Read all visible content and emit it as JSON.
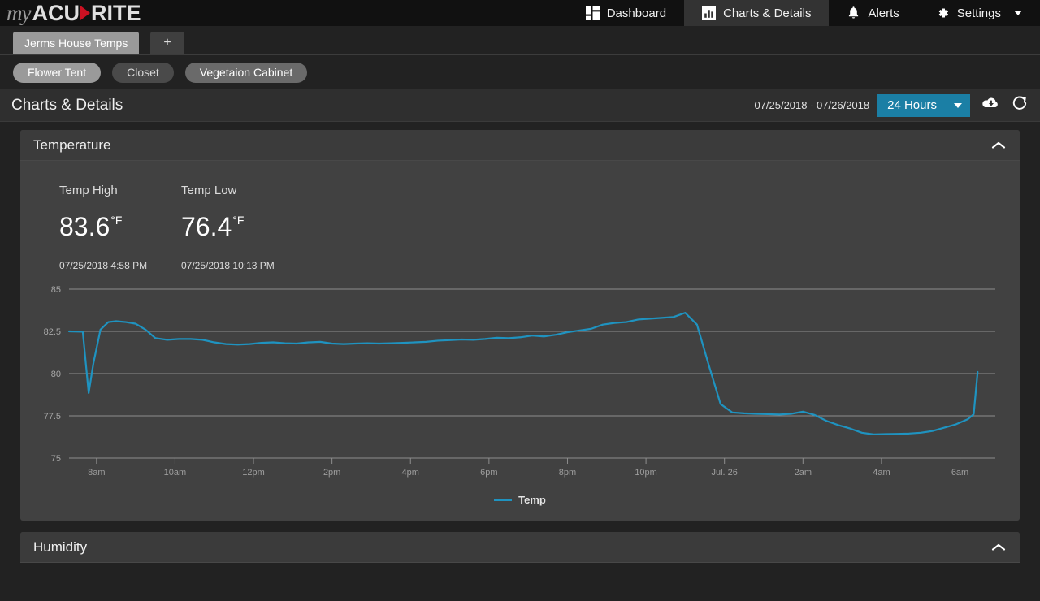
{
  "brand": {
    "my": "my",
    "acu": "ACU",
    "rite": "RITE"
  },
  "nav": {
    "items": [
      {
        "label": "Dashboard",
        "icon": "dashboard-grid-icon",
        "active": false
      },
      {
        "label": "Charts & Details",
        "icon": "bar-chart-icon",
        "active": true
      },
      {
        "label": "Alerts",
        "icon": "bell-icon",
        "active": false
      },
      {
        "label": "Settings",
        "icon": "gear-icon",
        "active": false
      }
    ]
  },
  "tabs": {
    "items": [
      {
        "label": "Jerms House Temps",
        "active": true
      }
    ],
    "add_label": "+"
  },
  "devices": {
    "items": [
      {
        "label": "Flower Tent",
        "state": "active"
      },
      {
        "label": "Closet",
        "state": "dim"
      },
      {
        "label": "Vegetaion Cabinet",
        "state": "mid"
      }
    ]
  },
  "section": {
    "title": "Charts & Details",
    "date_range": "07/25/2018 - 07/26/2018",
    "range_value": "24 Hours",
    "download_icon": "cloud-download-icon",
    "refresh_icon": "refresh-icon",
    "accent_color": "#1b7fa5"
  },
  "temperature_panel": {
    "title": "Temperature",
    "collapse_icon": "chevron-up-icon",
    "stats": [
      {
        "label": "Temp High",
        "value": "83.6",
        "unit": "°F",
        "timestamp": "07/25/2018 4:58 PM"
      },
      {
        "label": "Temp Low",
        "value": "76.4",
        "unit": "°F",
        "timestamp": "07/25/2018 10:13 PM"
      }
    ]
  },
  "humidity_panel": {
    "title": "Humidity",
    "collapse_icon": "chevron-up-icon"
  },
  "chart_data": {
    "type": "line",
    "title": "Temperature",
    "xlabel": "",
    "ylabel": "",
    "ylim": [
      75,
      85
    ],
    "yticks": [
      85,
      82.5,
      80,
      77.5,
      75
    ],
    "xticks": [
      "8am",
      "10am",
      "12pm",
      "2pm",
      "4pm",
      "6pm",
      "8pm",
      "10pm",
      "Jul. 26",
      "2am",
      "4am",
      "6am"
    ],
    "grid": true,
    "legend_position": "bottom",
    "line_color": "#1f93c0",
    "series": [
      {
        "name": "Temp",
        "x": [
          0.0,
          0.35,
          0.5,
          0.62,
          0.8,
          1.0,
          1.2,
          1.45,
          1.7,
          1.95,
          2.2,
          2.5,
          2.8,
          3.1,
          3.4,
          3.7,
          4.0,
          4.3,
          4.6,
          4.9,
          5.2,
          5.5,
          5.8,
          6.1,
          6.4,
          6.7,
          7.0,
          7.3,
          7.6,
          7.9,
          8.2,
          8.5,
          8.8,
          9.1,
          9.4,
          9.7,
          10.0,
          10.3,
          10.6,
          10.9,
          11.2,
          11.5,
          11.8,
          12.1,
          12.4,
          12.7,
          13.0,
          13.3,
          13.6,
          13.9,
          14.2,
          14.5,
          14.8,
          15.1,
          15.4,
          15.7,
          16.0,
          16.3,
          16.6,
          16.9,
          17.2,
          17.5,
          17.8,
          18.1,
          18.4,
          18.7,
          19.0,
          19.3,
          19.6,
          19.9,
          20.2,
          20.5,
          20.8,
          21.1,
          21.4,
          21.7,
          22.0,
          22.3,
          22.6,
          22.9,
          23.05,
          23.15
        ],
        "values": [
          82.5,
          82.48,
          78.85,
          80.6,
          82.6,
          83.05,
          83.1,
          83.05,
          82.95,
          82.6,
          82.1,
          82.0,
          82.05,
          82.05,
          82.0,
          81.85,
          81.75,
          81.72,
          81.75,
          81.82,
          81.85,
          81.8,
          81.78,
          81.85,
          81.88,
          81.78,
          81.75,
          81.78,
          81.8,
          81.78,
          81.8,
          81.82,
          81.85,
          81.88,
          81.95,
          81.98,
          82.02,
          82.0,
          82.05,
          82.12,
          82.1,
          82.15,
          82.25,
          82.2,
          82.3,
          82.45,
          82.55,
          82.65,
          82.9,
          83.0,
          83.05,
          83.2,
          83.25,
          83.3,
          83.35,
          83.6,
          82.9,
          80.5,
          78.2,
          77.7,
          77.65,
          77.62,
          77.6,
          77.58,
          77.62,
          77.75,
          77.55,
          77.2,
          76.95,
          76.75,
          76.5,
          76.4,
          76.42,
          76.43,
          76.45,
          76.5,
          76.6,
          76.8,
          77.0,
          77.3,
          77.6,
          80.1
        ]
      }
    ]
  }
}
